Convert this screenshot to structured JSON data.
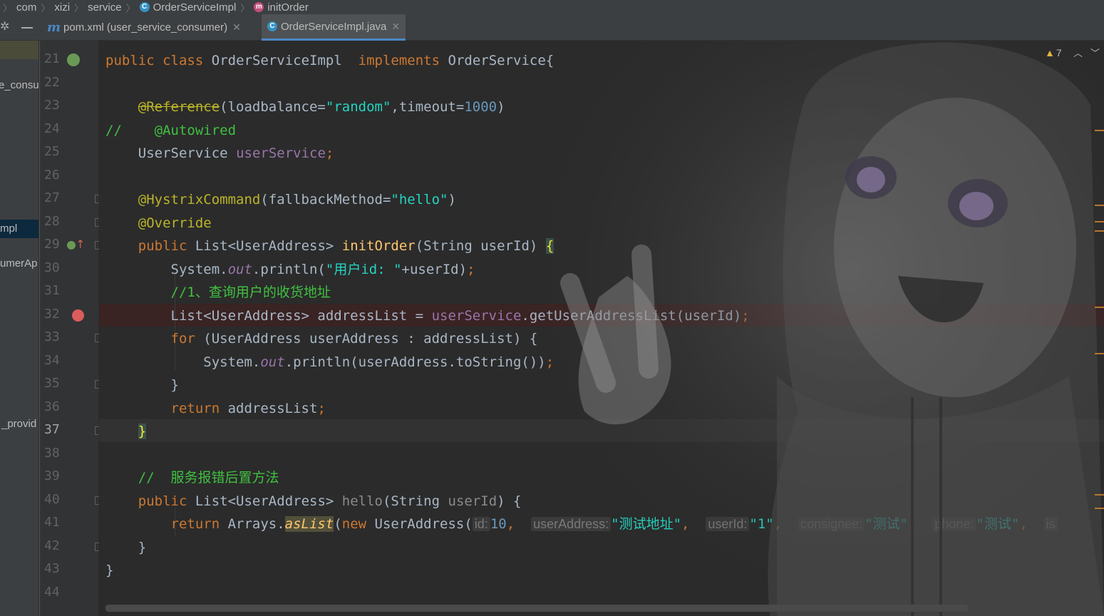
{
  "breadcrumb": {
    "items": [
      "com",
      "xizi",
      "service",
      "OrderServiceImpl",
      "initOrder"
    ]
  },
  "tabs": [
    {
      "label": "pom.xml (user_service_consumer)",
      "icon": "maven-icon",
      "active": false
    },
    {
      "label": "OrderServiceImpl.java",
      "icon": "class-icon",
      "active": true
    }
  ],
  "sidebar": {
    "items": [
      "e_consu",
      "mpl",
      "umerAp",
      "_provid"
    ]
  },
  "gutter": {
    "line_numbers": [
      "21",
      "22",
      "23",
      "24",
      "25",
      "26",
      "27",
      "28",
      "29",
      "30",
      "31",
      "32",
      "33",
      "34",
      "35",
      "36",
      "37",
      "38",
      "39",
      "40",
      "41",
      "42",
      "43",
      "44"
    ],
    "current_line": "37",
    "breakpoint_line": "32"
  },
  "inspections": {
    "warning_count": "7"
  },
  "code": {
    "l21_pub": "public",
    "l21_class": "class",
    "l21_name": "OrderServiceImpl",
    "l21_impl": "implements",
    "l21_iface": "OrderService{",
    "l23_ann": "@Reference",
    "l23_open": "(loadbalance=",
    "l23_str": "\"random\"",
    "l23_mid": ",timeout=",
    "l23_num": "1000",
    "l23_close": ")",
    "l24_slash": "//",
    "l24_ann": "@Autowired",
    "l25_type": "UserService",
    "l25_field": "userService",
    "l25_semi": ";",
    "l27_ann": "@HystrixCommand",
    "l27_open": "(fallbackMethod=",
    "l27_str": "\"hello\"",
    "l27_close": ")",
    "l28_ann": "@Override",
    "l29_pub": "public",
    "l29_type": "List<UserAddress>",
    "l29_fn": "initOrder",
    "l29_args": "(String userId)",
    "l29_brace": "{",
    "l30_sys": "System.",
    "l30_out": "out",
    "l30_println": ".println(",
    "l30_str": "\"用户id: \"",
    "l30_rest": "+userId)",
    "l30_semi": ";",
    "l31_cmt": "//1、查询用户的收货地址",
    "l32_decl": "List<UserAddress> addressList = ",
    "l32_field": "userService",
    "l32_call": ".getUserAddressList(userId)",
    "l32_semi": ";",
    "l33_for": "for",
    "l33_rest": " (UserAddress userAddress : addressList) {",
    "l34_sys": "System.",
    "l34_out": "out",
    "l34_rest": ".println(userAddress.toString())",
    "l34_semi": ";",
    "l35_close": "}",
    "l36_ret": "return",
    "l36_rest": " addressList",
    "l36_semi": ";",
    "l37_close": "}",
    "l39_cmt": "//  服务报错后置方法",
    "l40_pub": "public",
    "l40_type": "List<UserAddress>",
    "l40_fn": "hello",
    "l40_open": "(String ",
    "l40_arg": "userId",
    "l40_close": ") {",
    "l41_ret": "return",
    "l41_arrays": " Arrays.",
    "l41_aslist": "asList",
    "l41_paren": "(",
    "l41_new": "new",
    "l41_ctor": " UserAddress(",
    "l41_hint_id": "id:",
    "l41_id": "10",
    "l41_hint_addr": "userAddress:",
    "l41_addr": "\"测试地址\"",
    "l41_hint_uid": "userId:",
    "l41_uid": "\"1\"",
    "l41_hint_con": "consignee:",
    "l41_con": "\"测试\"",
    "l41_hint_phone": "phone:",
    "l41_phone": "\"测试\"",
    "l41_trunc": "is",
    "l42_close": "}",
    "l43_close": "}",
    "comma": ","
  }
}
